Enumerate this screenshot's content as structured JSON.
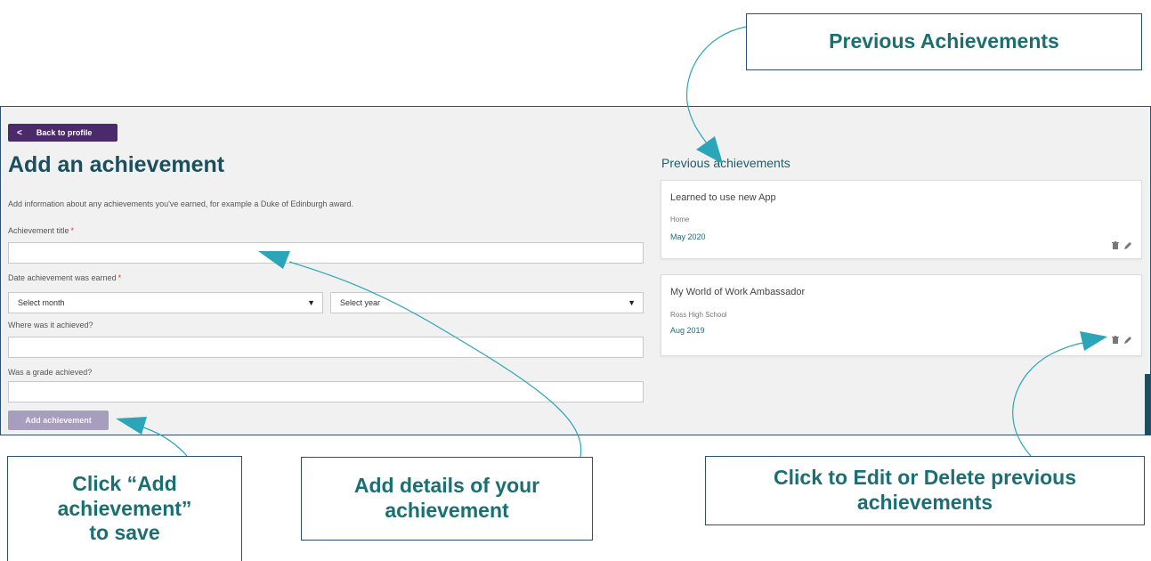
{
  "form": {
    "back_label": "Back to profile",
    "back_chevron": "<",
    "title": "Add an achievement",
    "intro": "Add information about any achievements you've earned, for example a Duke of Edinburgh award.",
    "required_mark": "*",
    "title_label": "Achievement title",
    "date_label": "Date achievement was earned",
    "month_placeholder": "Select month",
    "year_placeholder": "Select year",
    "where_label": "Where was it achieved?",
    "grade_label": "Was a grade achieved?",
    "submit_label": "Add achievement",
    "dropdown_arrow": "▼"
  },
  "previous": {
    "heading": "Previous achievements",
    "items": [
      {
        "title": "Learned to use new App",
        "location": "Home",
        "date": "May 2020"
      },
      {
        "title": "My World of Work Ambassador",
        "location": "Ross High School",
        "date": "Aug 2019"
      }
    ]
  },
  "callouts": {
    "previous": "Previous Achievements",
    "add_line1": "Click “Add",
    "add_line2": "achievement”",
    "add_line3": "to save",
    "details_line1": "Add details of your",
    "details_line2": "achievement",
    "edit_line1": "Click to Edit or Delete previous",
    "edit_line2": "achievements"
  },
  "colors": {
    "accent": "#1b6f73",
    "arrow": "#2aa6b8",
    "back_button": "#4a2a6a",
    "submit_button": "#a79dbf"
  }
}
